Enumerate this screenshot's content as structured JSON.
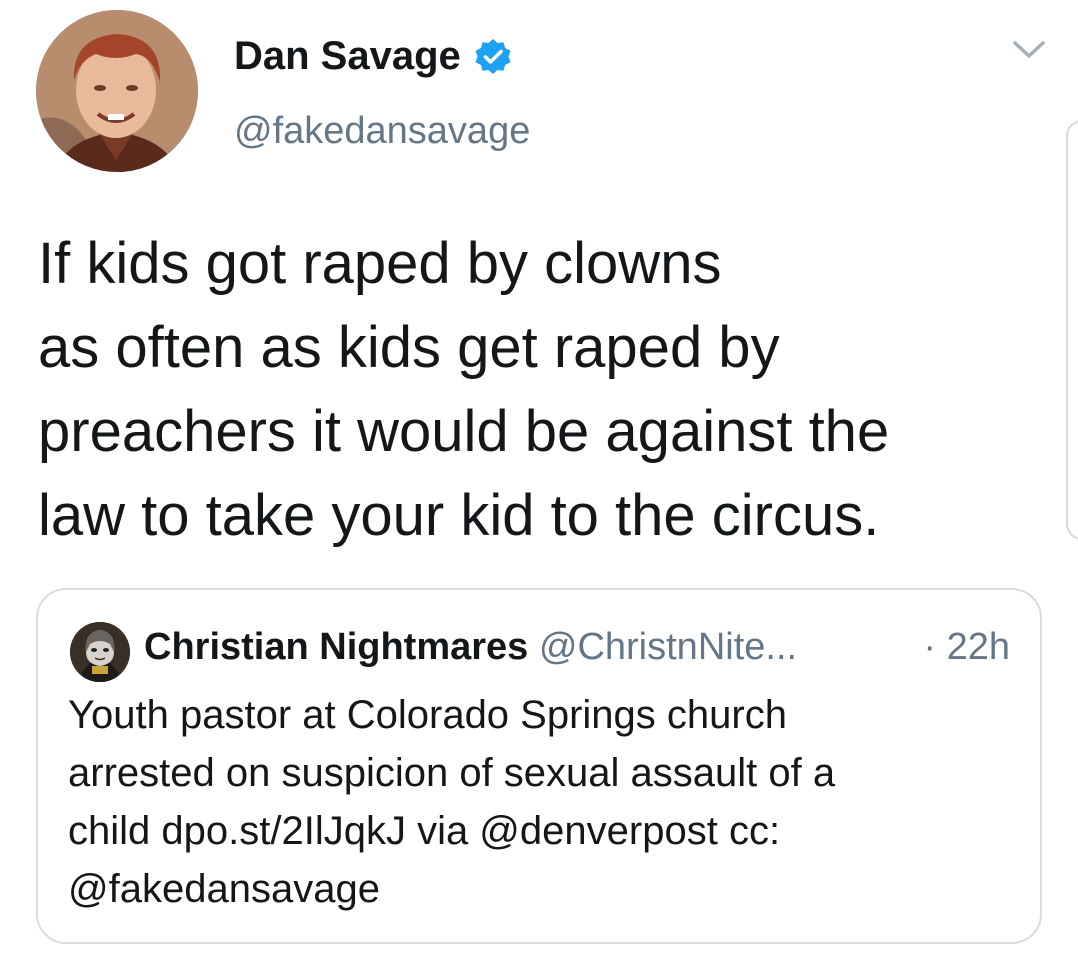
{
  "author": {
    "name": "Dan Savage",
    "handle": "@fakedansavage",
    "verified": true
  },
  "tweet": {
    "lines": [
      "If kids got raped by clowns",
      "as often as kids get raped by",
      "preachers it would be against the",
      "law to take your kid to the circus."
    ]
  },
  "quoted_tweet": {
    "name": "Christian Nightmares",
    "handle": "@ChristnNite...",
    "time": "· 22h",
    "lines": [
      "Youth pastor at Colorado Springs church",
      "arrested on suspicion of sexual assault of a",
      "child dpo.st/2IlJqkJ via @denverpost cc:",
      "@fakedansavage"
    ]
  },
  "icons": {
    "verified": "verified-badge-icon",
    "menu": "chevron-down-icon"
  },
  "colors": {
    "verified": "#1da1f2",
    "text": "#14171a",
    "secondary": "#657786",
    "border": "#d9dde1"
  }
}
